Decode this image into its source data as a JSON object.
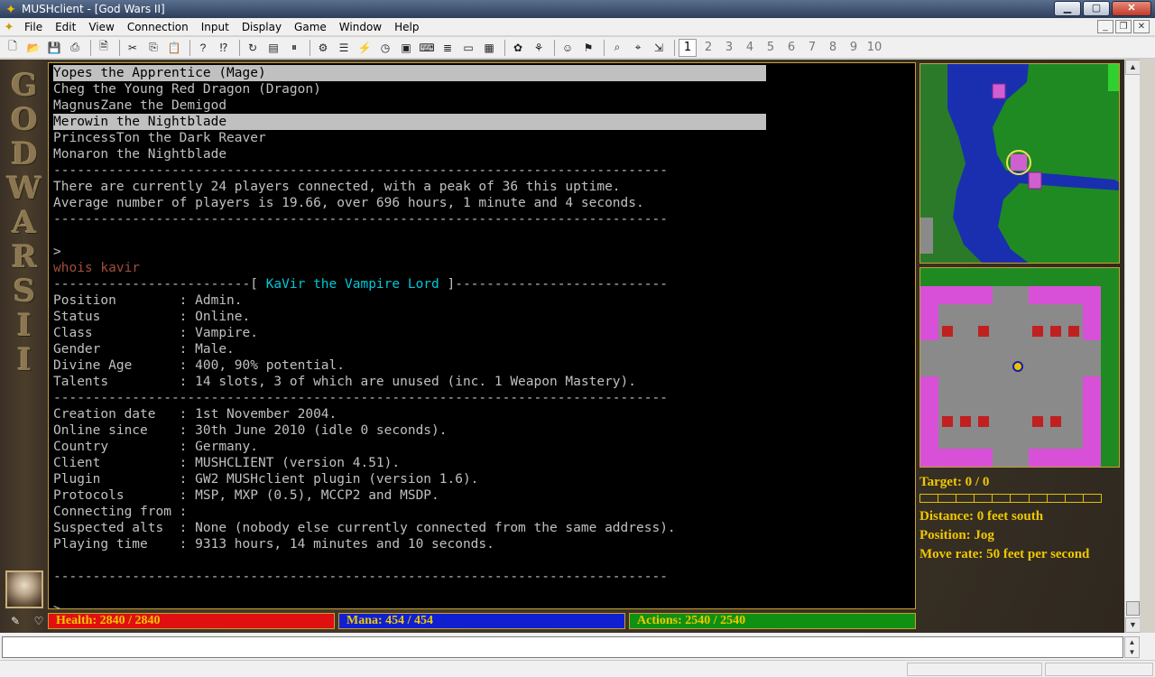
{
  "window": {
    "title": "MUSHclient - [God Wars II]"
  },
  "menu": [
    "File",
    "Edit",
    "View",
    "Connection",
    "Input",
    "Display",
    "Game",
    "Window",
    "Help"
  ],
  "toolbar": {
    "worlds": [
      "1",
      "2",
      "3",
      "4",
      "5",
      "6",
      "7",
      "8",
      "9",
      "10"
    ],
    "active_world": "1"
  },
  "sidebar": {
    "logo_text": "GOD WARS II"
  },
  "terminal": {
    "lines": [
      {
        "text": "Yopes the Apprentice (Mage)",
        "style": "hl"
      },
      {
        "text": "Cheg the Young Red Dragon (Dragon)",
        "style": ""
      },
      {
        "text": "MagnusZane the Demigod",
        "style": ""
      },
      {
        "text": "Merowin the Nightblade",
        "style": "hl"
      },
      {
        "text": "PrincessTon the Dark Reaver",
        "style": ""
      },
      {
        "text": "Monaron the Nightblade",
        "style": ""
      },
      {
        "text": "------------------------------------------------------------------------------",
        "style": ""
      },
      {
        "text": "There are currently 24 players connected, with a peak of 36 this uptime.",
        "style": ""
      },
      {
        "text": "Average number of players is 19.66, over 696 hours, 1 minute and 4 seconds.",
        "style": ""
      },
      {
        "text": "------------------------------------------------------------------------------",
        "style": ""
      },
      {
        "text": "",
        "style": ""
      },
      {
        "text": ">",
        "style": ""
      },
      {
        "text": "whois kavir",
        "style": "cmd"
      },
      {
        "text": "",
        "style": "header"
      },
      {
        "text": "Position        : Admin.",
        "style": ""
      },
      {
        "text": "Status          : Online.",
        "style": ""
      },
      {
        "text": "Class           : Vampire.",
        "style": ""
      },
      {
        "text": "Gender          : Male.",
        "style": ""
      },
      {
        "text": "Divine Age      : 400, 90% potential.",
        "style": ""
      },
      {
        "text": "Talents         : 14 slots, 3 of which are unused (inc. 1 Weapon Mastery).",
        "style": ""
      },
      {
        "text": "------------------------------------------------------------------------------",
        "style": ""
      },
      {
        "text": "Creation date   : 1st November 2004.",
        "style": ""
      },
      {
        "text": "Online since    : 30th June 2010 (idle 0 seconds).",
        "style": ""
      },
      {
        "text": "Country         : Germany.",
        "style": ""
      },
      {
        "text": "Client          : MUSHCLIENT (version 4.51).",
        "style": ""
      },
      {
        "text": "Plugin          : GW2 MUSHclient plugin (version 1.6).",
        "style": ""
      },
      {
        "text": "Protocols       : MSP, MXP (0.5), MCCP2 and MSDP.",
        "style": ""
      },
      {
        "text": "Connecting from :",
        "style": ""
      },
      {
        "text": "Suspected alts  : None (nobody else currently connected from the same address).",
        "style": ""
      },
      {
        "text": "Playing time    : 9313 hours, 14 minutes and 10 seconds.",
        "style": ""
      },
      {
        "text": "",
        "style": ""
      },
      {
        "text": "------------------------------------------------------------------------------",
        "style": ""
      },
      {
        "text": "",
        "style": ""
      },
      {
        "text": ">",
        "style": ""
      }
    ],
    "header": {
      "left_dashes": "-------------------------[ ",
      "name": "KaVir the Vampire Lord",
      "right_dashes": " ]---------------------------"
    }
  },
  "info": {
    "target": "Target: 0 / 0",
    "distance": "Distance: 0 feet south",
    "position": "Position: Jog",
    "move_rate": "Move rate: 50 feet per second"
  },
  "status": {
    "health": {
      "label": "Health: 2840 / 2840",
      "current": 2840,
      "max": 2840,
      "color": "#e01010"
    },
    "mana": {
      "label": "Mana: 454 / 454",
      "current": 454,
      "max": 454,
      "color": "#1020d0"
    },
    "actions": {
      "label": "Actions: 2540 / 2540",
      "current": 2540,
      "max": 2540,
      "color": "#109010"
    }
  },
  "input": {
    "value": ""
  },
  "colors": {
    "terminal_bg": "#000000",
    "terminal_text": "#c0c0c0",
    "highlight_bg": "#c0c0c0",
    "command_text": "#a04e3a",
    "name_cyan": "#00c8d8",
    "info_gold": "#f0c800",
    "frame_gold": "#c8a030"
  }
}
